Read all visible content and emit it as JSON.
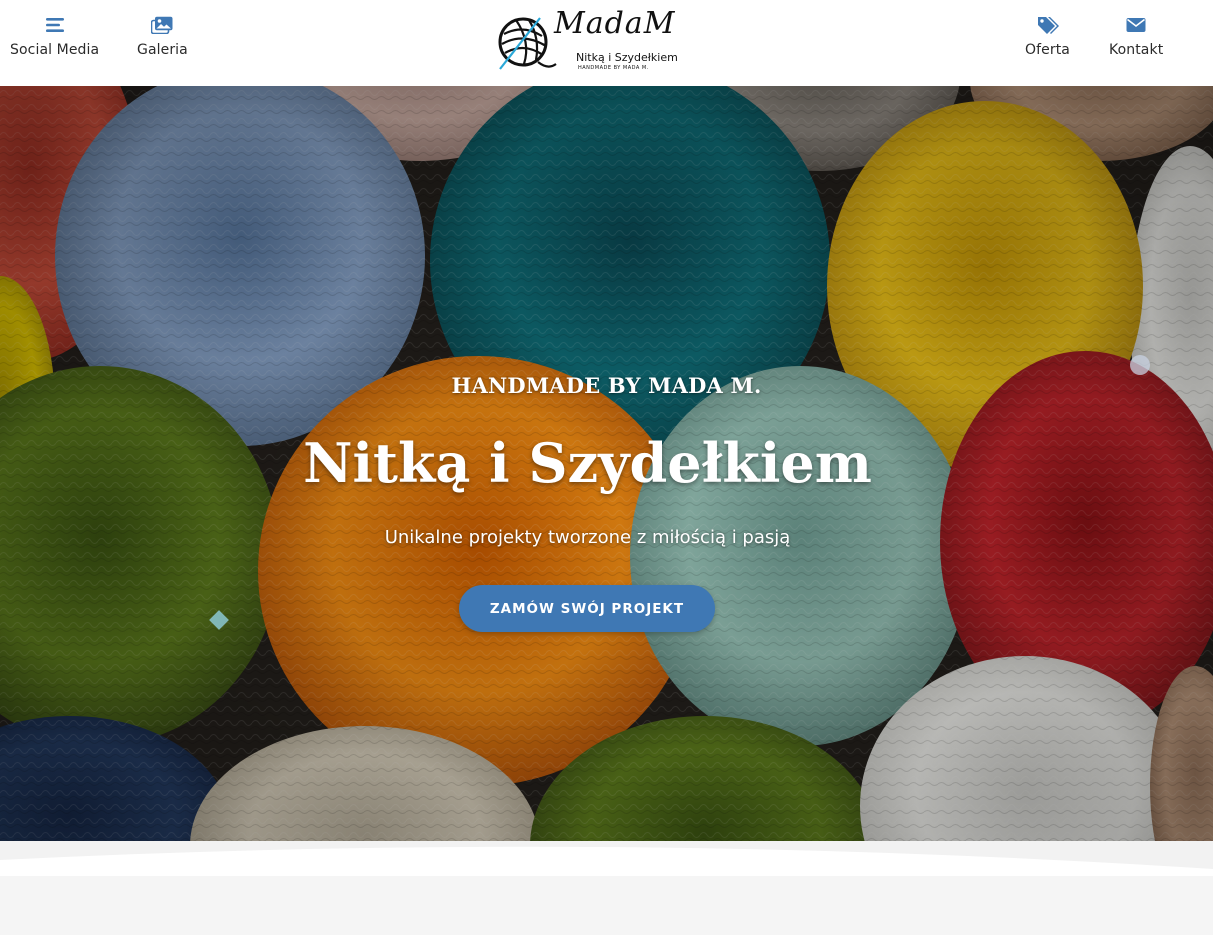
{
  "header": {
    "nav_left": [
      {
        "label": "Social Media",
        "icon": "menu-bars-icon"
      },
      {
        "label": "Galeria",
        "icon": "images-icon"
      }
    ],
    "nav_right": [
      {
        "label": "Oferta",
        "icon": "tags-icon"
      },
      {
        "label": "Kontakt",
        "icon": "envelope-icon"
      }
    ],
    "logo": {
      "script_text": "MadaM",
      "brand_text": "Nitką i Szydełkiem",
      "tagline": "HANDMADE BY MADA M."
    },
    "icon_color": "#3f78b4"
  },
  "hero": {
    "kicker": "HANDMADE BY MADA M.",
    "title": "Nitką i Szydełkiem",
    "subtitle": "Unikalne projekty tworzone z miłością i pasją",
    "cta_label": "ZAMÓW SWÓJ PROJEKT",
    "cta_color": "#3f78b4",
    "background": "yarn-skeins-photo"
  }
}
